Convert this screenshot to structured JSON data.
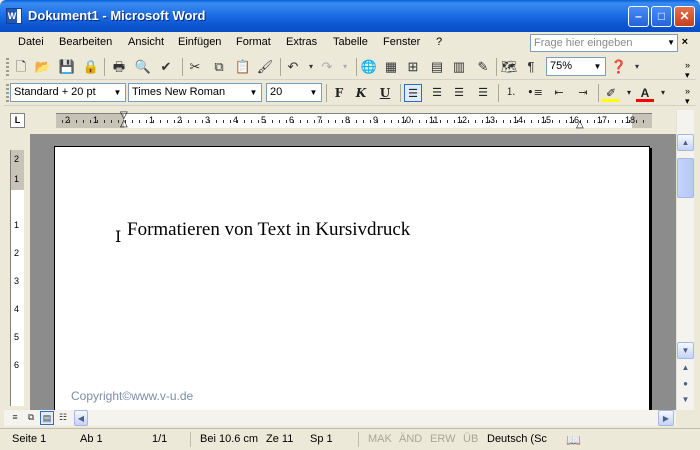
{
  "window": {
    "title": "Dokument1 - Microsoft Word",
    "minimize": "–",
    "maximize": "□",
    "close": "✕"
  },
  "menu": {
    "items": [
      "Datei",
      "Bearbeiten",
      "Ansicht",
      "Einfügen",
      "Format",
      "Extras",
      "Tabelle",
      "Fenster",
      "?"
    ],
    "ask_placeholder": "Frage hier eingeben",
    "doc_close": "×"
  },
  "standard_toolbar": {
    "zoom": "75%"
  },
  "format_toolbar": {
    "style": "Standard + 20 pt",
    "font": "Times New Roman",
    "size": "20",
    "bold": "F",
    "italic": "K",
    "underline": "U",
    "highlight_color": "#ffff00",
    "font_color": "#ff0000"
  },
  "ruler": {
    "numbers": [
      "2",
      "1",
      "1",
      "2",
      "3",
      "4",
      "5",
      "6",
      "7",
      "8",
      "9",
      "10",
      "11",
      "12",
      "13",
      "14",
      "15",
      "16",
      "17",
      "18"
    ],
    "tab_selector": "L"
  },
  "vertical_ruler": {
    "numbers": [
      "2",
      "1",
      "1",
      "2",
      "3",
      "4",
      "5",
      "6"
    ]
  },
  "document": {
    "text": "Formatieren von Text in Kursivdruck",
    "watermark": "Copyright©www.v-u.de"
  },
  "status": {
    "page": "Seite  1",
    "section": "Ab  1",
    "pages": "1/1",
    "at": "Bei  10.6 cm",
    "line": "Ze  11",
    "col": "Sp  1",
    "mak": "MAK",
    "aend": "ÄND",
    "erw": "ERW",
    "ueb": "ÜB",
    "language": "Deutsch (Sc"
  }
}
